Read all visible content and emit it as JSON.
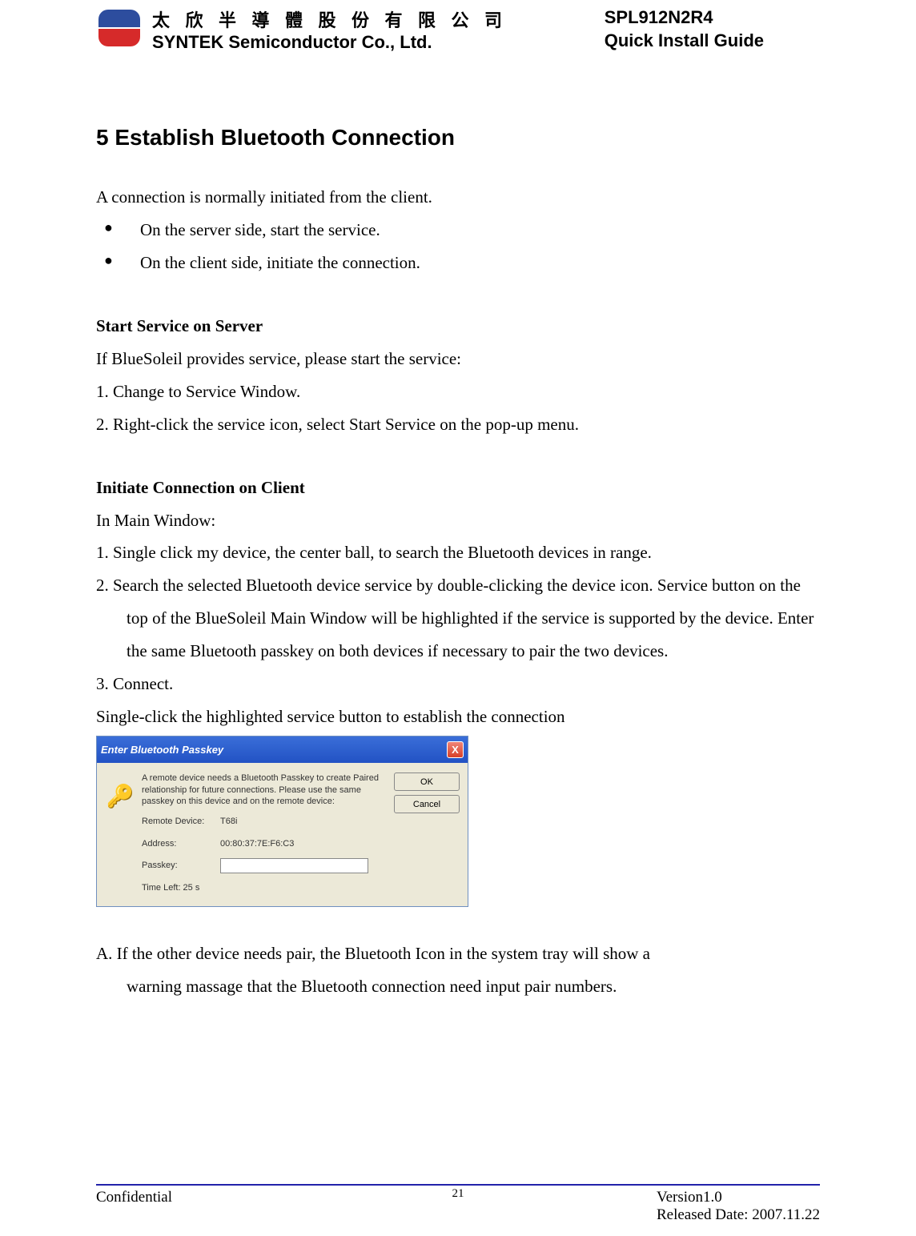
{
  "header": {
    "company_cn": "太 欣 半 導 體 股 份 有 限 公 司",
    "company_en": "SYNTEK Semiconductor Co., Ltd.",
    "product": "SPL912N2R4",
    "doc_type": "Quick Install Guide"
  },
  "section": {
    "title": "5 Establish Bluetooth Connection",
    "intro": "A connection is normally initiated from the client.",
    "bullets": [
      "On the server side, start the service.",
      "On the client side, initiate the connection."
    ]
  },
  "server_section": {
    "title": "Start Service on Server",
    "intro": "If BlueSoleil provides service, please start the service:",
    "steps": [
      "1.   Change to Service Window.",
      "2.   Right-click the service icon, select Start Service on the pop-up menu."
    ]
  },
  "client_section": {
    "title": "Initiate Connection on Client",
    "intro": "In Main Window:",
    "steps": [
      "1.   Single click my device, the center ball, to search the Bluetooth devices in range.",
      "2.   Search the selected Bluetooth device service by double-clicking the device icon. Service button on the top of the BlueSoleil Main Window will be highlighted if the service is supported by the device. Enter the same Bluetooth passkey on both devices if necessary to pair the two devices.",
      "3.   Connect."
    ],
    "post_text": "Single-click the highlighted service button to establish the connection"
  },
  "dialog": {
    "title": "Enter Bluetooth Passkey",
    "message": "A remote device needs a Bluetooth Passkey to create Paired relationship for future connections. Please use the same passkey on this device and on the remote device:",
    "labels": {
      "remote_device": "Remote Device:",
      "address": "Address:",
      "passkey": "Passkey:",
      "time_left": "Time Left: 25 s"
    },
    "values": {
      "remote_device": "T68i",
      "address": "00:80:37:7E:F6:C3",
      "passkey": ""
    },
    "buttons": {
      "ok": "OK",
      "cancel": "Cancel"
    },
    "close_icon": "X"
  },
  "note_a": {
    "line1": "A. If the other device needs pair, the Bluetooth Icon in the system tray will show a",
    "line2": "warning massage that the Bluetooth connection need input pair numbers."
  },
  "footer": {
    "confidential": "Confidential",
    "page_number": "21",
    "version": "Version1.0",
    "release_date": "Released Date: 2007.11.22"
  }
}
